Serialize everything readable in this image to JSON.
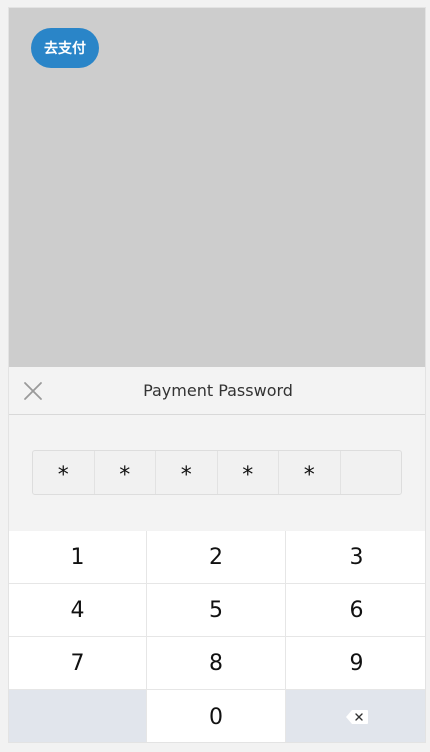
{
  "page": {
    "pay_button_label": "去支付"
  },
  "sheet": {
    "title": "Payment Password",
    "close_icon": "close-icon",
    "password": {
      "digits_total": 6,
      "digits_entered": 5,
      "mask_char": "*",
      "cells": [
        "*",
        "*",
        "*",
        "*",
        "*",
        ""
      ]
    }
  },
  "keypad": {
    "keys": [
      "1",
      "2",
      "3",
      "4",
      "5",
      "6",
      "7",
      "8",
      "9",
      "",
      "0",
      ""
    ],
    "delete_icon": "backspace-icon"
  },
  "colors": {
    "accent": "#2a85c8",
    "backdrop": "#cdcdcd",
    "sheet_bg": "#f3f3f3",
    "key_bg": "#ffffff",
    "special_key_bg": "#e1e5ec"
  }
}
